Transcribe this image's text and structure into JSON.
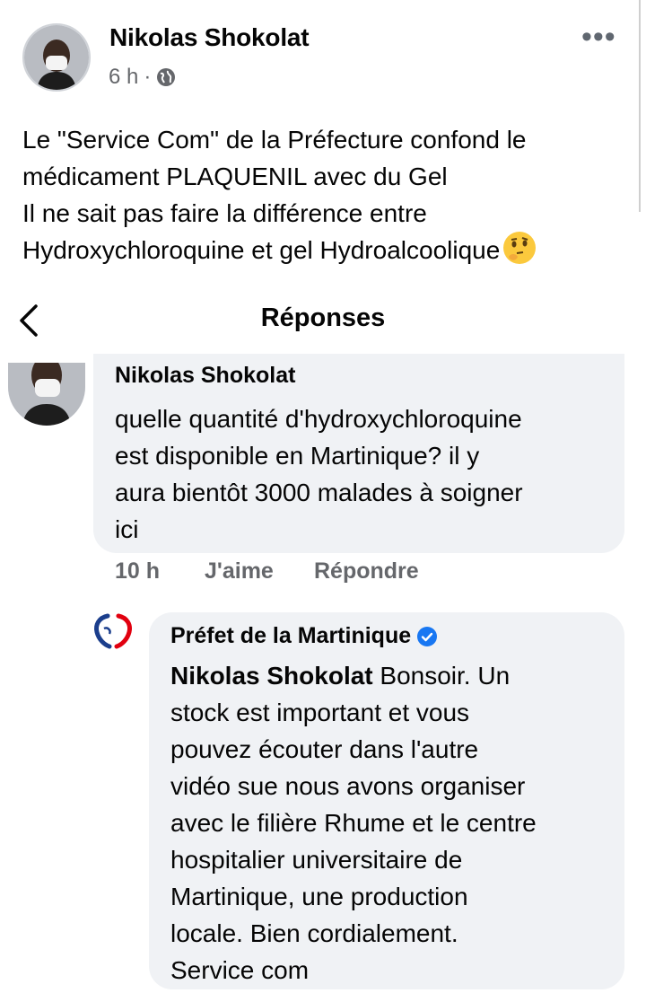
{
  "post": {
    "author": "Nikolas Shokolat",
    "time": "6 h",
    "separator": "·",
    "more": "•••",
    "lines": [
      "Le \"Service Com\" de la Préfecture confond le",
      "médicament PLAQUENIL avec du Gel",
      "Il ne sait pas faire la différence entre",
      "Hydroxychloroquine et gel Hydroalcoolique"
    ],
    "emoji": "thinking-face-icon"
  },
  "header": {
    "title": "Réponses",
    "back_icon": "chevron-left-icon"
  },
  "comment1": {
    "author": "Nikolas Shokolat",
    "lines": [
      "quelle quantité d'hydroxychloroquine",
      "est disponible en Martinique? il y",
      "aura bientôt 3000 malades à soigner",
      "ici"
    ],
    "time": "10 h",
    "like": "J'aime",
    "reply": "Répondre"
  },
  "comment2": {
    "author": "Préfet de la Martinique",
    "verified": "verified-badge-icon",
    "mention": "Nikolas Shokolat",
    "first_line_rest": " Bonsoir. Un",
    "lines": [
      "stock est important et vous",
      "pouvez écouter dans l'autre",
      "vidéo sue nous avons organiser",
      "avec le filière Rhume et le centre",
      "hospitalier universitaire de",
      "Martinique, une production",
      "locale. Bien cordialement.",
      "Service com"
    ]
  },
  "colors": {
    "bubble": "#f0f2f5",
    "meta": "#65676b",
    "verified": "#1877f2"
  }
}
